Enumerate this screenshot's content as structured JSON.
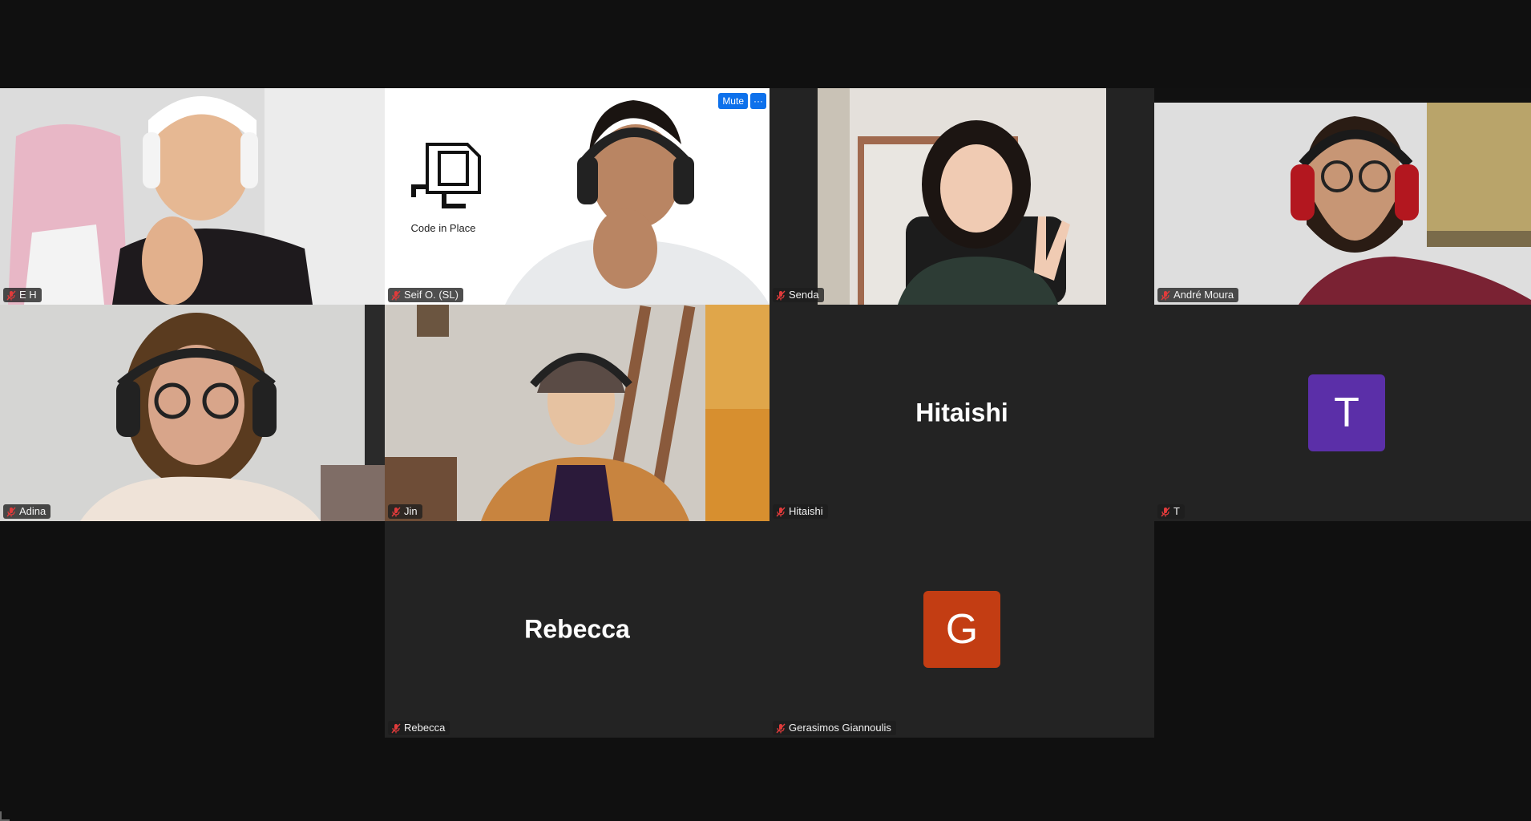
{
  "meeting": {
    "participants": [
      {
        "id": "eh",
        "name": "E H",
        "muted": true,
        "video": true
      },
      {
        "id": "seif",
        "name": "Seif O. (SL)",
        "muted": true,
        "video": true,
        "logo_caption": "Code in Place",
        "actions": {
          "mute_label": "Mute",
          "more_label": "···"
        }
      },
      {
        "id": "senda",
        "name": "Senda",
        "muted": true,
        "video": true
      },
      {
        "id": "andre",
        "name": "André Moura",
        "muted": true,
        "video": true,
        "active_speaker": true
      },
      {
        "id": "adina",
        "name": "Adina",
        "muted": true,
        "video": true
      },
      {
        "id": "jin",
        "name": "Jin",
        "muted": true,
        "video": true
      },
      {
        "id": "hitaishi",
        "name": "Hitaishi",
        "display_name": "Hitaishi",
        "muted": true,
        "video": false
      },
      {
        "id": "t",
        "name": "T",
        "avatar_letter": "T",
        "avatar_color": "#5b2fa8",
        "muted": true,
        "video": false
      },
      {
        "id": "rebecca",
        "name": "Rebecca",
        "display_name": "Rebecca",
        "muted": true,
        "video": false
      },
      {
        "id": "gerasimos",
        "name": "Gerasimos Giannoulis",
        "avatar_letter": "G",
        "avatar_color": "#c33d13",
        "muted": true,
        "video": false
      }
    ]
  },
  "colors": {
    "background": "#101010",
    "tile_background": "#232323",
    "active_speaker_border": "#3ec77b",
    "mute_button": "#0e71eb",
    "mic_off": "#e03b3b"
  }
}
